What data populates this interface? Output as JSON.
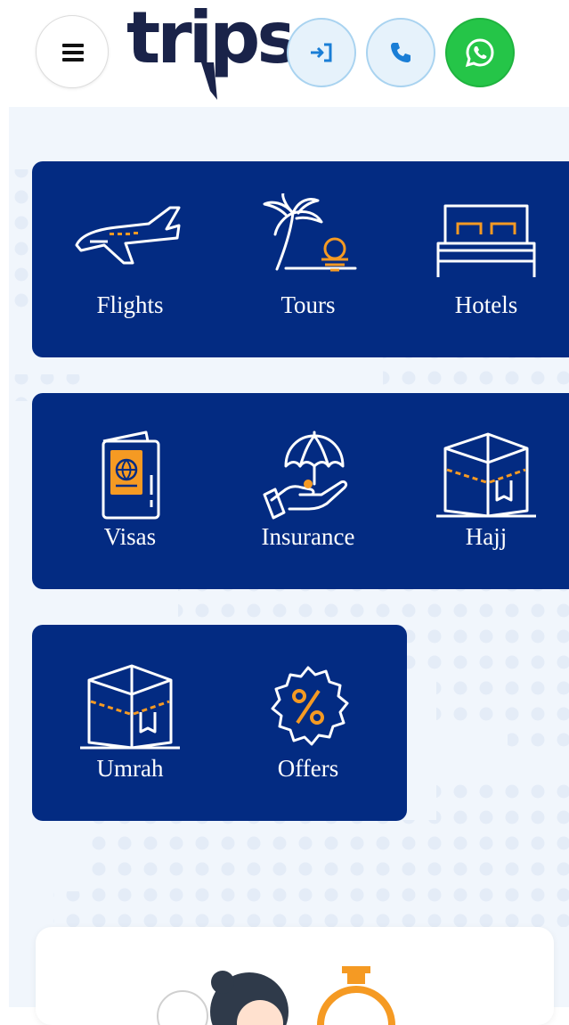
{
  "header": {
    "logo_text": "trips",
    "menu_icon": "hamburger-icon",
    "buttons": [
      {
        "name": "login",
        "icon": "login-icon"
      },
      {
        "name": "call",
        "icon": "phone-icon"
      },
      {
        "name": "whatsapp",
        "icon": "whatsapp-icon"
      }
    ]
  },
  "services": [
    {
      "label": "Flights",
      "icon": "airplane-icon"
    },
    {
      "label": "Tours",
      "icon": "palm-beach-icon"
    },
    {
      "label": "Hotels",
      "icon": "bed-icon"
    },
    {
      "label": "Visas",
      "icon": "passport-icon"
    },
    {
      "label": "Insurance",
      "icon": "umbrella-hand-icon"
    },
    {
      "label": "Hajj",
      "icon": "kaaba-icon"
    },
    {
      "label": "Umrah",
      "icon": "kaaba-icon"
    },
    {
      "label": "Offers",
      "icon": "percent-badge-icon"
    }
  ],
  "colors": {
    "brand_navy": "#032b82",
    "accent_orange": "#f59a23",
    "whatsapp_green": "#25c548",
    "light_blue": "#e6f2fb"
  }
}
